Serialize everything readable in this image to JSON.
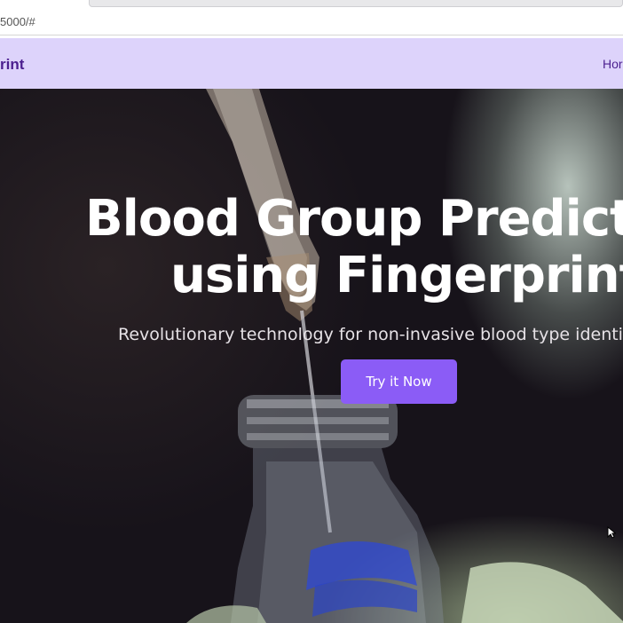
{
  "browser": {
    "url": "5000/#"
  },
  "navbar": {
    "brand": "rint",
    "home_link": "Hor"
  },
  "hero": {
    "title_line1": "Blood Group Predict",
    "title_line2": "using Fingerprint",
    "subtitle": "Revolutionary technology for non-invasive blood type identif",
    "cta_label": "Try it Now"
  },
  "colors": {
    "navbar_bg": "#ddd3fb",
    "brand_text": "#4b1f8f",
    "cta_bg": "#8b5cf6",
    "hero_text": "#ffffff"
  }
}
